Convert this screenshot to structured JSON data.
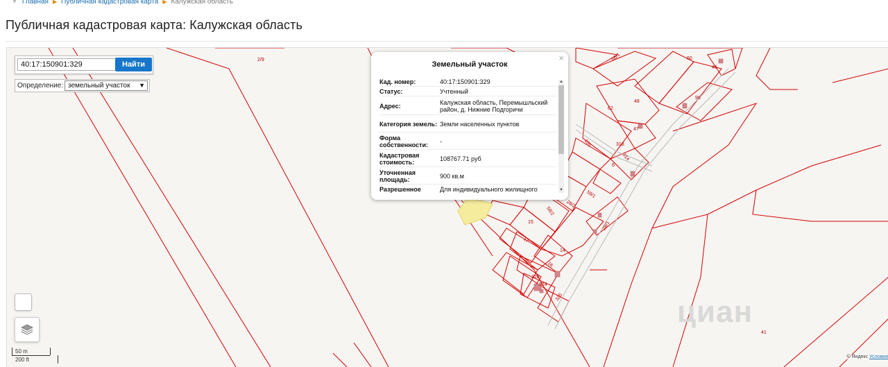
{
  "breadcrumbs": [
    "Главная",
    "Публичная кадастровая карта",
    "Калужская область"
  ],
  "page_title": "Публичная кадастровая карта: Калужская область",
  "search": {
    "value": "40:17:150901:329",
    "button": "Найти"
  },
  "definition": {
    "label": "Определение:",
    "selected": "земельный участок"
  },
  "popup": {
    "title": "Земельный участок",
    "close": "×",
    "rows": [
      {
        "key": "Кад. номер:",
        "value": "40:17:150901:329"
      },
      {
        "key": "Статус:",
        "value": "Учтенный"
      },
      {
        "key": "Адрес:",
        "value": "Калужская область, Перемышльский район, д. Нижние Подгоричи"
      },
      {
        "key": "Категория земель:",
        "value": "Земли населенных пунктов"
      },
      {
        "key": "Форма собственности:",
        "value": "-"
      },
      {
        "key": "Кадастровая стоимость:",
        "value": "108767.71 руб"
      },
      {
        "key": "Уточненная площадь:",
        "value": "900 кв.м"
      },
      {
        "key": "Разрешенное",
        "value": "Для индивидуального жилищного"
      }
    ]
  },
  "parcel_labels": [
    "2/9",
    "66/1",
    "60",
    "46",
    "98",
    "48",
    "62",
    "47",
    "105",
    "318",
    "314",
    "6",
    "59/1",
    "28/2",
    "58/2",
    "15",
    "28/1",
    "17",
    "14",
    "16",
    "326",
    "324",
    "325",
    "41"
  ],
  "scale": {
    "metric": "50 m",
    "imperial": "200 ft"
  },
  "copyright": {
    "provider": "© Яндекс",
    "terms": "Условия"
  },
  "watermark": "циан",
  "colors": {
    "parcel_line": "#d40000",
    "accent": "#1776c9",
    "selected_parcel": "#f5ec9e"
  }
}
